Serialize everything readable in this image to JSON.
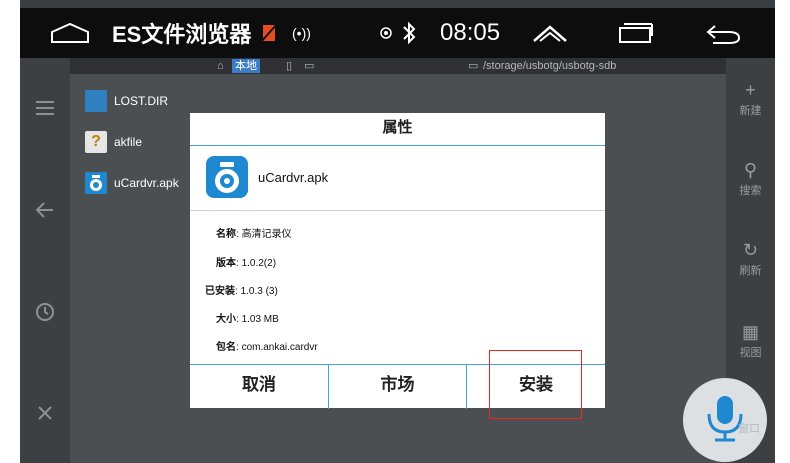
{
  "status_bar": {
    "app_title": "ES文件浏览器",
    "time": "08:05",
    "radio_symbol": "(•))"
  },
  "path_bar": {
    "local_label": "本地",
    "path": "/storage/usbotg/usbotg-sdb"
  },
  "files": [
    {
      "name": "LOST.DIR",
      "icon": "folder-icon"
    },
    {
      "name": "akfile",
      "icon": "unknown-file-icon"
    },
    {
      "name": "uCardvr.apk",
      "icon": "apk-icon"
    }
  ],
  "right_nav": [
    {
      "label": "新建",
      "icon": "plus-icon",
      "glyph": "+"
    },
    {
      "label": "搜索",
      "icon": "search-icon",
      "glyph": "⚲"
    },
    {
      "label": "刷新",
      "icon": "refresh-icon",
      "glyph": "↻"
    },
    {
      "label": "视图",
      "icon": "grid-icon",
      "glyph": "▦"
    }
  ],
  "dialog": {
    "title": "属性",
    "app_name": "uCardvr.apk",
    "props": [
      {
        "label": "名称",
        "value": "高清记录仪"
      },
      {
        "label": "版本",
        "value": "1.0.2(2)"
      },
      {
        "label": "已安装",
        "value": "1.0.3 (3)"
      },
      {
        "label": "大小",
        "value": "1.03 MB"
      },
      {
        "label": "包名",
        "value": "com.ankai.cardvr"
      }
    ],
    "buttons": {
      "cancel": "取消",
      "market": "市场",
      "install": "安装"
    }
  },
  "voice": {
    "label": "窗口"
  },
  "colors": {
    "accent_line": "#43a4d9",
    "highlight": "#e8291f",
    "apk_blue": "#1e88d1"
  }
}
